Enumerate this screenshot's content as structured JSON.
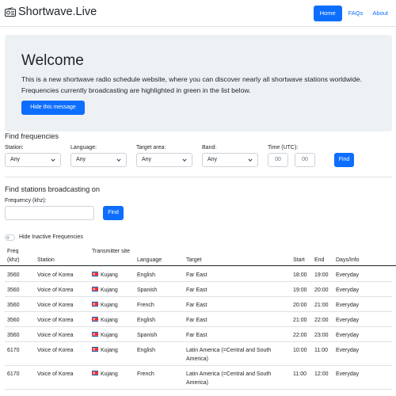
{
  "nav": {
    "brand": "Shortwave.Live",
    "links": [
      "Home",
      "FAQs",
      "About"
    ]
  },
  "welcome": {
    "title": "Welcome",
    "text": "This is a new shortwave radio schedule website, where you can discover nearly all shortwave stations worldwide. Frequencies currently broadcasting are highlighted in green in the list below.",
    "button": "Hide this message"
  },
  "find_frequencies": {
    "title": "Find frequencies",
    "station_label": "Station:",
    "station_value": "Any",
    "language_label": "Language:",
    "language_value": "Any",
    "target_label": "Target area:",
    "target_value": "Any",
    "band_label": "Band:",
    "band_value": "Any",
    "time_label": "Time (UTC):",
    "time_from_placeholder": "00",
    "time_to_placeholder": "00",
    "find_button": "Find"
  },
  "find_stations": {
    "title": "Find stations broadcasting on",
    "freq_label": "Frequency (khz):",
    "find_button": "Find"
  },
  "toggle_label": "Hide Inactive Frequencies",
  "table": {
    "headers": {
      "freq": "Freq (khz)",
      "station": "Station",
      "site": "Transmitter site",
      "language": "Language",
      "target": "Target",
      "start": "Start",
      "end": "End",
      "days": "Days/Info"
    },
    "rows": [
      {
        "freq": "3560",
        "station": "Voice of Korea",
        "site": "Kujang",
        "language": "English",
        "target": "Far East",
        "start": "18:00",
        "end": "19:00",
        "days": "Everyday"
      },
      {
        "freq": "3560",
        "station": "Voice of Korea",
        "site": "Kujang",
        "language": "Spanish",
        "target": "Far East",
        "start": "19:00",
        "end": "20:00",
        "days": "Everyday"
      },
      {
        "freq": "3560",
        "station": "Voice of Korea",
        "site": "Kujang",
        "language": "French",
        "target": "Far East",
        "start": "20:00",
        "end": "21:00",
        "days": "Everyday"
      },
      {
        "freq": "3560",
        "station": "Voice of Korea",
        "site": "Kujang",
        "language": "English",
        "target": "Far East",
        "start": "21:00",
        "end": "22:00",
        "days": "Everyday"
      },
      {
        "freq": "3560",
        "station": "Voice of Korea",
        "site": "Kujang",
        "language": "Spanish",
        "target": "Far East",
        "start": "22:00",
        "end": "23:00",
        "days": "Everyday"
      },
      {
        "freq": "6170",
        "station": "Voice of Korea",
        "site": "Kujang",
        "language": "English",
        "target": "Latin America (=Central and South America)",
        "start": "10:00",
        "end": "11:00",
        "days": "Everyday"
      },
      {
        "freq": "6170",
        "station": "Voice of Korea",
        "site": "Kujang",
        "language": "French",
        "target": "Latin America (=Central and South America)",
        "start": "11:00",
        "end": "12:00",
        "days": "Everyday"
      }
    ]
  },
  "colors": {
    "accent": "#0d6efd",
    "jumbotron_bg": "#eef1f4",
    "text": "#212529"
  }
}
